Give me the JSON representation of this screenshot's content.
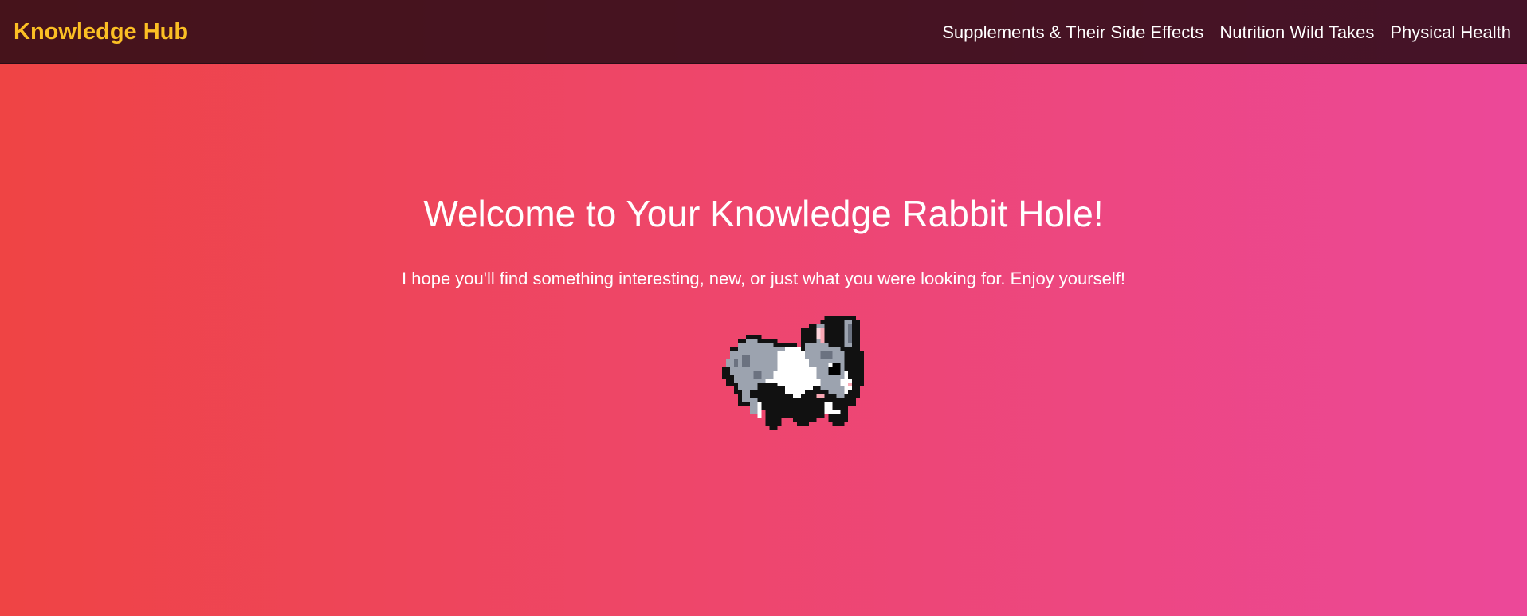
{
  "header": {
    "brand": "Knowledge Hub",
    "nav": [
      {
        "label": "Supplements & Their Side Effects"
      },
      {
        "label": "Nutrition Wild Takes"
      },
      {
        "label": "Physical Health"
      }
    ]
  },
  "hero": {
    "title": "Welcome to Your Knowledge Rabbit Hole!",
    "subtitle": "I hope you'll find something interesting, new, or just what you were looking for. Enjoy yourself!",
    "image_icon": "pixel-rabbit"
  },
  "colors": {
    "gradient_start": "#ef4444",
    "gradient_end": "#ec4899",
    "brand": "#fbbf24",
    "navbar_bg": "#3a1520",
    "text": "#ffffff"
  }
}
